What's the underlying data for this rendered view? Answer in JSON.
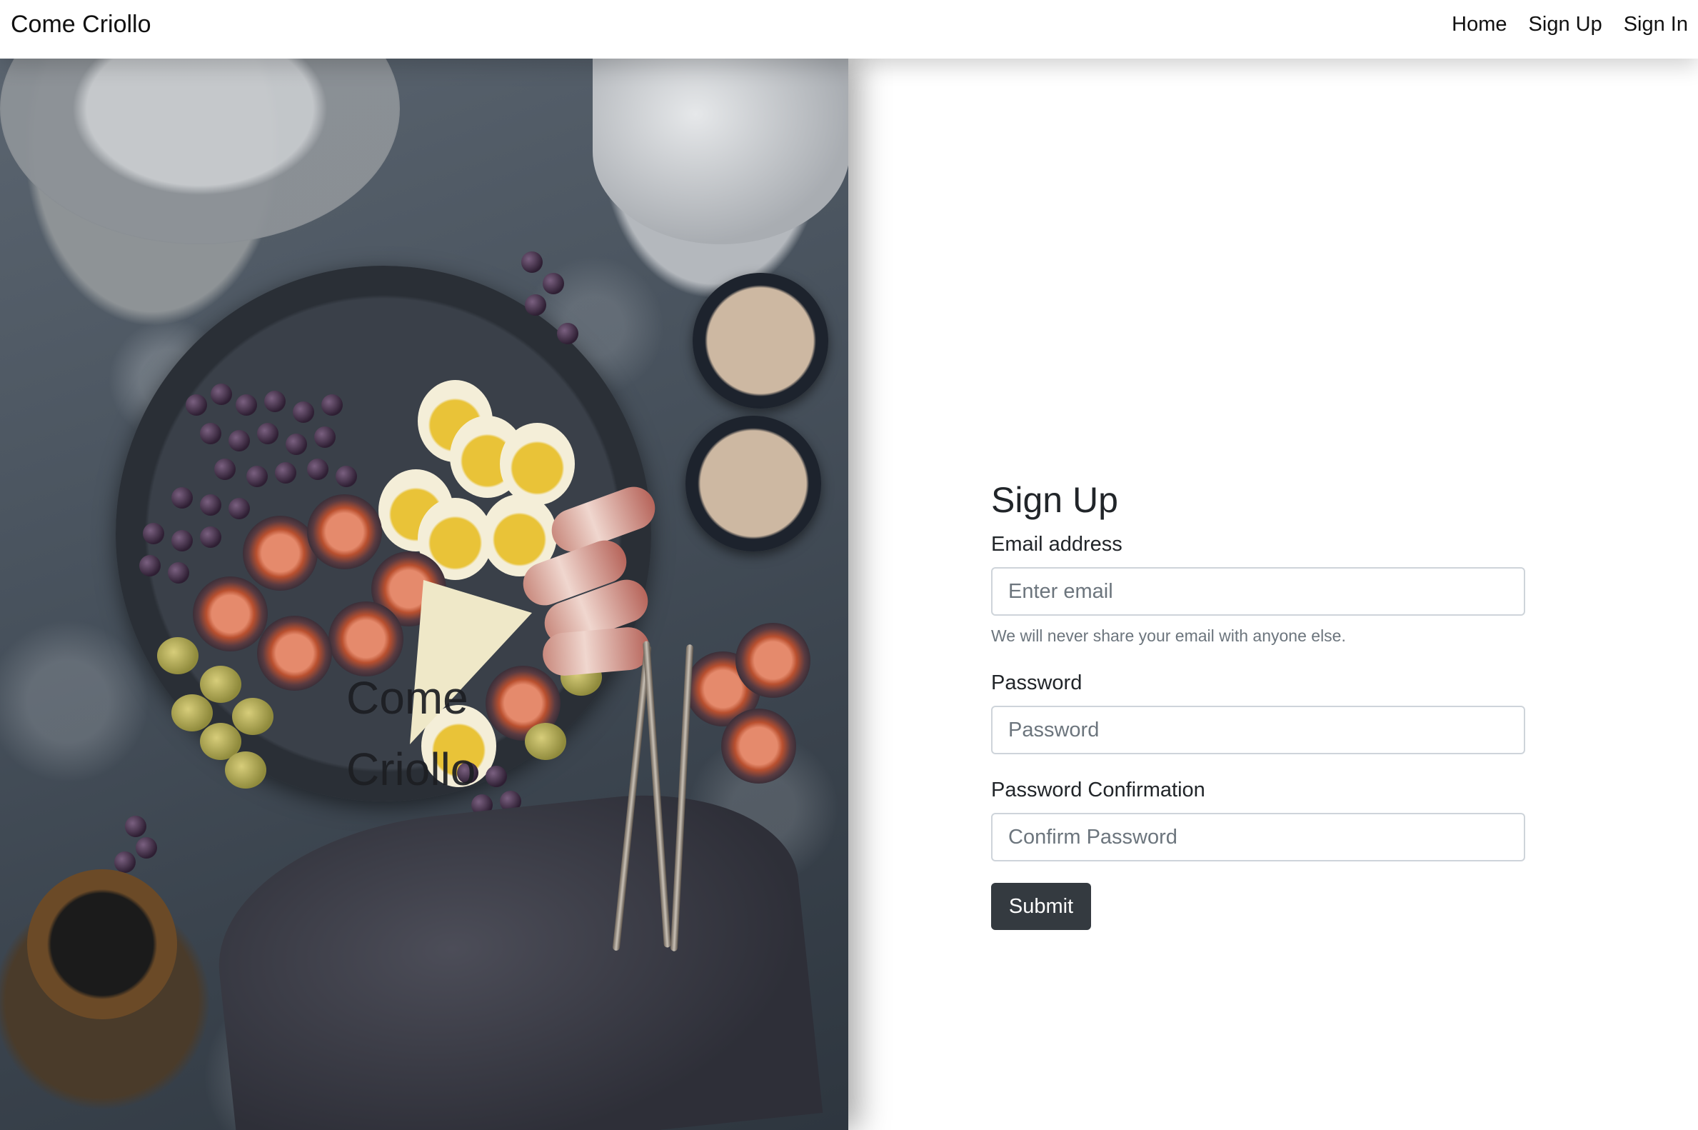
{
  "navbar": {
    "brand": "Come Criollo",
    "links": [
      "Home",
      "Sign Up",
      "Sign In"
    ]
  },
  "hero": {
    "title_line1": "Come",
    "title_line2": "Criollo"
  },
  "form": {
    "title": "Sign Up",
    "email_label": "Email address",
    "email_placeholder": "Enter email",
    "email_help": "We will never share your email with anyone else.",
    "password_label": "Password",
    "password_placeholder": "Password",
    "confirm_label": "Password Confirmation",
    "confirm_placeholder": "Confirm Password",
    "submit_label": "Submit"
  },
  "colors": {
    "button_bg": "#343a40",
    "input_border": "#ced4da",
    "help_text": "#6c757d"
  }
}
